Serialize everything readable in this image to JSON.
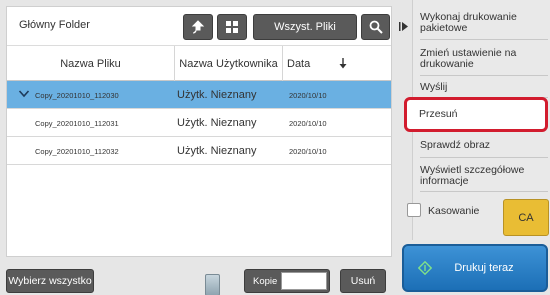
{
  "header": {
    "folder": "Główny Folder",
    "up_icon": "up-arrow-icon",
    "grid_icon": "grid-view-icon",
    "all_files": "Wszyst. Pliki",
    "search_icon": "search-icon"
  },
  "table": {
    "columns": [
      "Nazwa Pliku",
      "Nazwa Użytkownika",
      "Data"
    ],
    "sort_icon": "sort-down-icon",
    "rows": [
      {
        "name": "Copy_20201010_112030",
        "user": "Użytk. Nieznany",
        "date": "2020/10/10",
        "selected": true
      },
      {
        "name": "Copy_20201010_112031",
        "user": "Użytk. Nieznany",
        "date": "2020/10/10",
        "selected": false
      },
      {
        "name": "Copy_20201010_112032",
        "user": "Użytk. Nieznany",
        "date": "2020/10/10",
        "selected": false
      }
    ]
  },
  "bottom": {
    "select_all": "Wybierz wszystko",
    "copies_label": "Kopie",
    "copies_value": "",
    "delete": "Usuń"
  },
  "panel": {
    "items": [
      "Wykonaj drukowanie pakietowe",
      "Zmień ustawienie na drukowanie",
      "Wyślij",
      "Przesuń",
      "Sprawdź obraz",
      "Wyświetl szczegółowe informacje"
    ],
    "highlighted_index": 3,
    "delete_checkbox": "Kasowanie",
    "ca": "CA",
    "print_now": "Drukuj teraz"
  },
  "colors": {
    "selected_row": "#6ab0e2",
    "highlight_border": "#d21c2e",
    "ca_button": "#e9bd34",
    "print_button": "#1c6fb6"
  }
}
